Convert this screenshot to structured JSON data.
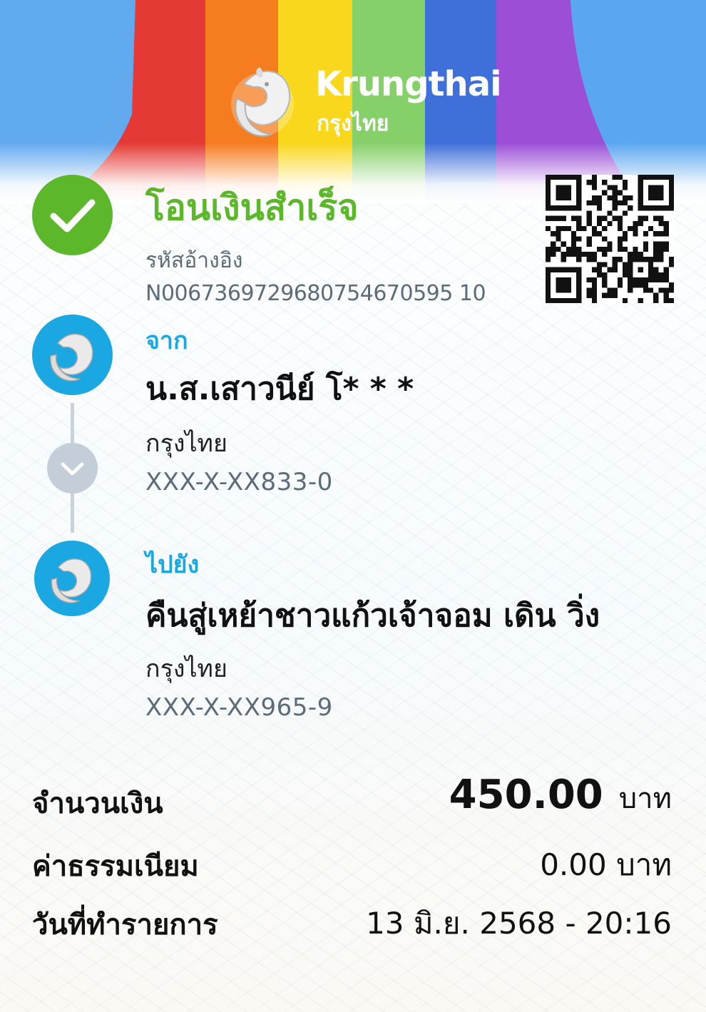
{
  "brand": {
    "name_en": "Krungthai",
    "name_th": "กรุงไทย",
    "rainbow_colors": [
      "#e53935",
      "#f57c1f",
      "#f9d71c",
      "#86d06a",
      "#3f6fd8",
      "#9a4fd6",
      "#3f8de0"
    ]
  },
  "status": {
    "title": "โอนเงินสำเร็จ",
    "color": "#5cb82a",
    "icon": "checkmark-icon"
  },
  "reference": {
    "label": "รหัสอ้างอิง",
    "value": "N0067369729680754670595 10"
  },
  "from": {
    "label": "จาก",
    "name": "น.ส.เสาวนีย์ โ* * *",
    "bank": "กรุงไทย",
    "account": "XXX-X-XX833-0"
  },
  "to": {
    "label": "ไปยัง",
    "name": "คืนสู่เหย้าชาวแก้วเจ้าจอม เดิน วิ่ง",
    "bank": "กรุงไทย",
    "account": "XXX-X-XX965-9"
  },
  "summary": {
    "amount_label": "จำนวนเงิน",
    "amount_value": "450.00",
    "amount_unit": "บาท",
    "fee_label": "ค่าธรรมเนียม",
    "fee_value": "0.00 บาท",
    "date_label": "วันที่ทำรายการ",
    "date_value": "13 มิ.ย. 2568 - 20:16"
  },
  "accent_color": "#1ba7e1"
}
